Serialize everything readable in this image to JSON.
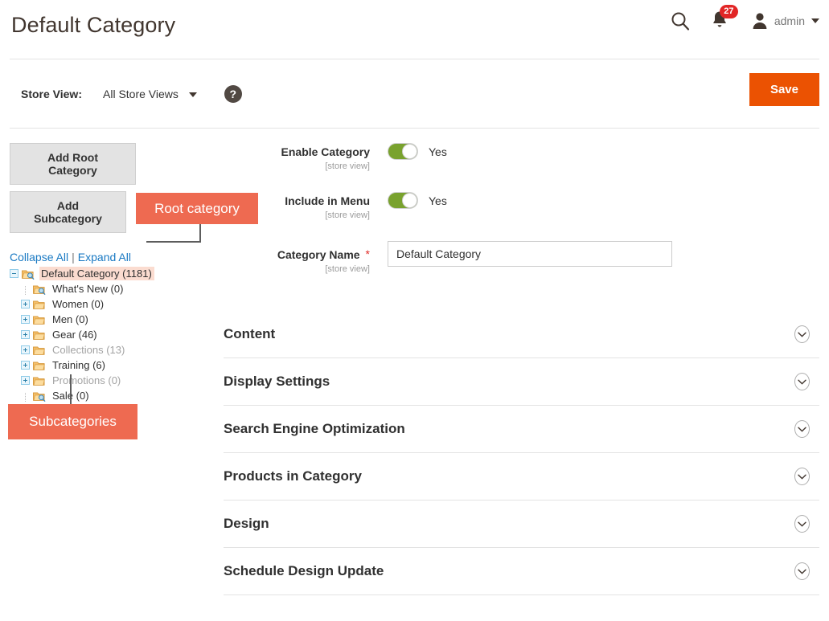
{
  "header": {
    "title": "Default Category",
    "search_icon": "search-icon",
    "notifications": {
      "icon": "bell-icon",
      "count": "27"
    },
    "user": {
      "avatar_icon": "user-avatar-icon",
      "name": "admin",
      "caret_icon": "chevron-down-icon"
    }
  },
  "storeview": {
    "label": "Store View:",
    "value": "All Store Views",
    "caret_icon": "chevron-down-icon",
    "help_icon": "?",
    "save_label": "Save"
  },
  "tree_panel": {
    "add_root_label": "Add Root Category",
    "add_sub_label": "Add Subcategory",
    "collapse_all": "Collapse All",
    "separator": "|",
    "expand_all": "Expand All",
    "nodes": [
      {
        "label": "Default Category (1181)",
        "depth": 0,
        "expander": "minus",
        "icon": "folder-search-icon",
        "selected": true,
        "muted": false
      },
      {
        "label": "What's New (0)",
        "depth": 1,
        "expander": "none",
        "icon": "folder-search-icon",
        "selected": false,
        "muted": false
      },
      {
        "label": "Women (0)",
        "depth": 1,
        "expander": "plus",
        "icon": "folder-icon",
        "selected": false,
        "muted": false
      },
      {
        "label": "Men (0)",
        "depth": 1,
        "expander": "plus",
        "icon": "folder-icon",
        "selected": false,
        "muted": false
      },
      {
        "label": "Gear (46)",
        "depth": 1,
        "expander": "plus",
        "icon": "folder-icon",
        "selected": false,
        "muted": false
      },
      {
        "label": "Collections (13)",
        "depth": 1,
        "expander": "plus",
        "icon": "folder-icon",
        "selected": false,
        "muted": true
      },
      {
        "label": "Training (6)",
        "depth": 1,
        "expander": "plus",
        "icon": "folder-icon",
        "selected": false,
        "muted": false
      },
      {
        "label": "Promotions (0)",
        "depth": 1,
        "expander": "plus",
        "icon": "folder-icon",
        "selected": false,
        "muted": true
      },
      {
        "label": "Sale (0)",
        "depth": 1,
        "expander": "none",
        "icon": "folder-search-icon",
        "selected": false,
        "muted": false
      }
    ]
  },
  "annotations": {
    "root_callout": "Root category",
    "sub_callout": "Subcategories"
  },
  "form": {
    "enable_category": {
      "label": "Enable Category",
      "scope": "[store view]",
      "toggle_value": "Yes",
      "on": true
    },
    "include_in_menu": {
      "label": "Include in Menu",
      "scope": "[store view]",
      "toggle_value": "Yes",
      "on": true
    },
    "category_name": {
      "label": "Category Name",
      "scope": "[store view]",
      "required_mark": "*",
      "value": "Default Category",
      "placeholder": ""
    }
  },
  "sections": [
    {
      "title": "Content",
      "icon": "chevron-down-icon",
      "expanded": false
    },
    {
      "title": "Display Settings",
      "icon": "chevron-down-icon",
      "expanded": false
    },
    {
      "title": "Search Engine Optimization",
      "icon": "chevron-down-icon",
      "expanded": false
    },
    {
      "title": "Products in Category",
      "icon": "chevron-down-icon",
      "expanded": false
    },
    {
      "title": "Design",
      "icon": "chevron-down-icon",
      "expanded": false
    },
    {
      "title": "Schedule Design Update",
      "icon": "chevron-down-icon",
      "expanded": false
    }
  ],
  "colors": {
    "brand_orange": "#eb5202",
    "callout_orange": "#ee6a51",
    "link_blue": "#1979c3",
    "toggle_green": "#79a22e",
    "badge_red": "#e22626",
    "selected_row": "#fbdcd0"
  }
}
